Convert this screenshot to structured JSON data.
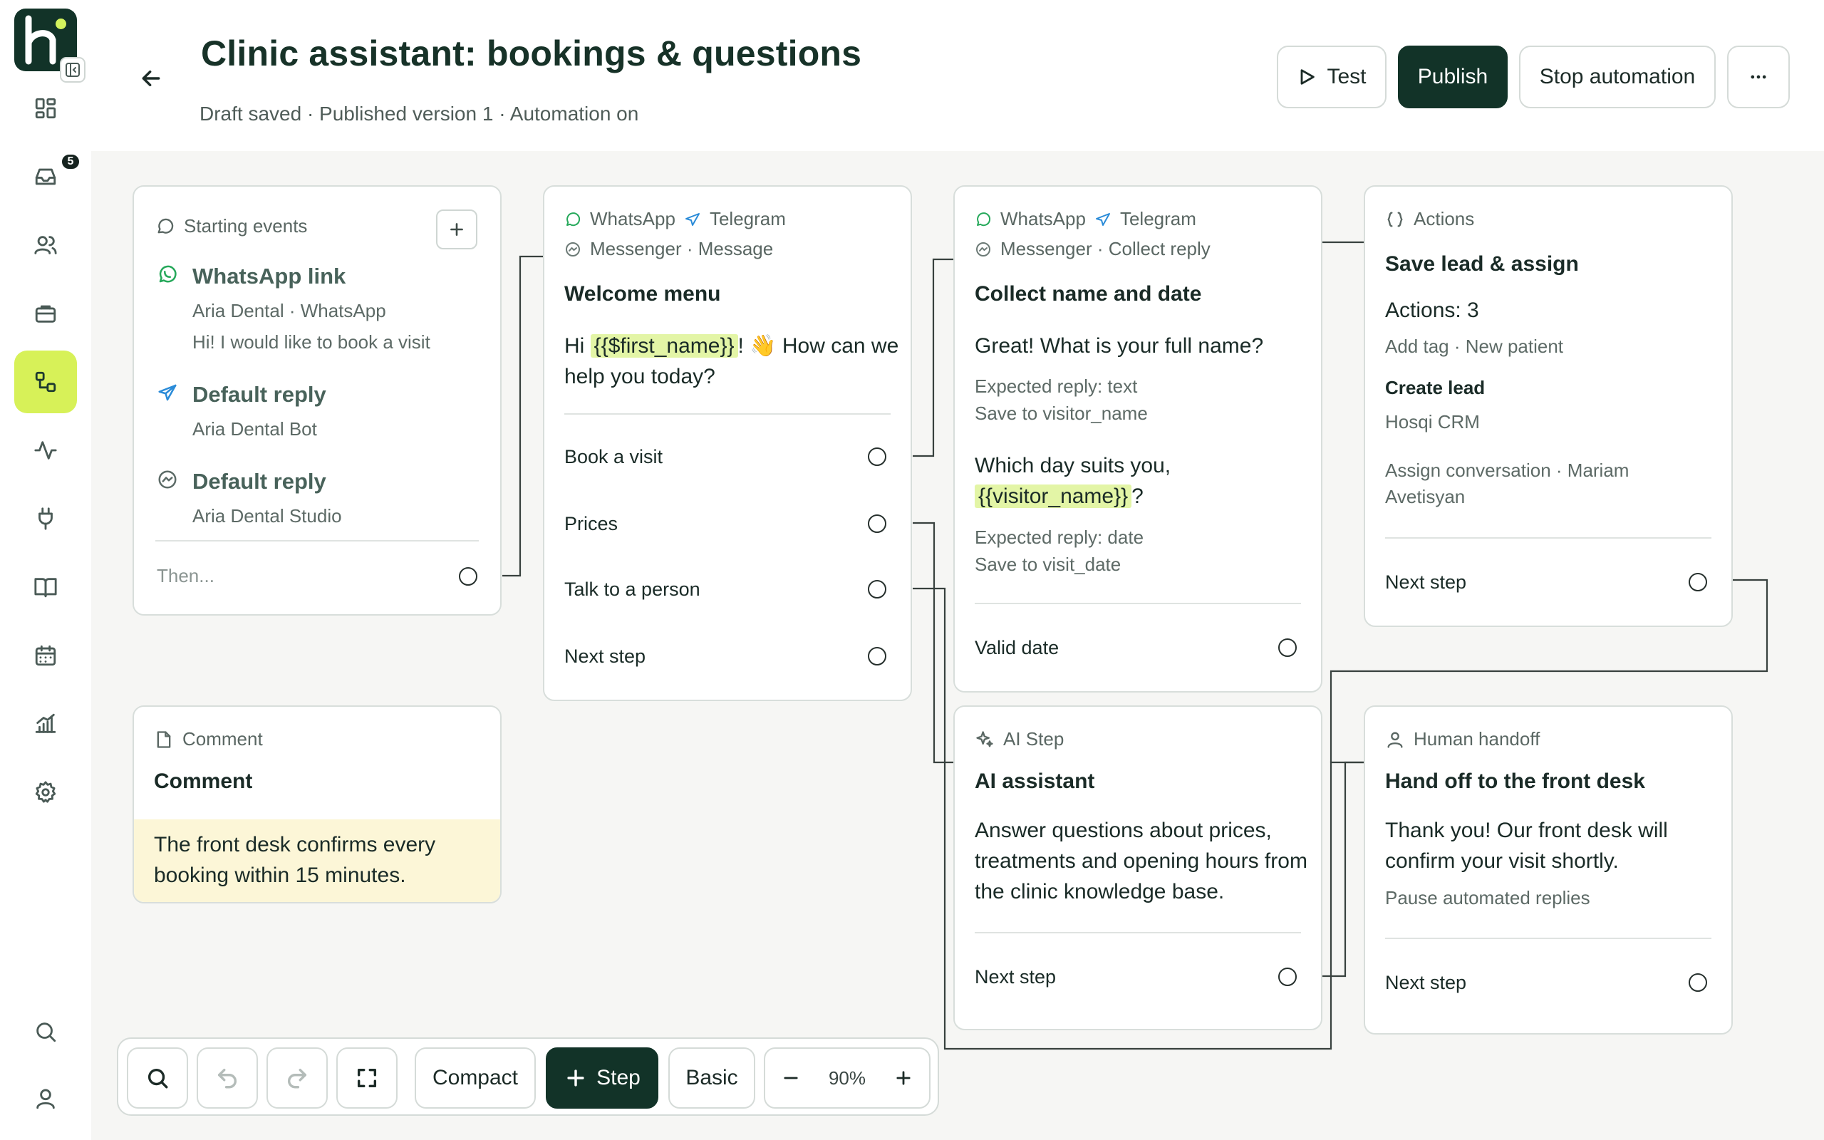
{
  "sidebar": {
    "inbox_badge": "5"
  },
  "header": {
    "title": "Clinic assistant: bookings & questions",
    "subtitle": "Draft saved · Published version 1 · Automation on",
    "test_label": "Test",
    "publish_label": "Publish",
    "stop_label": "Stop automation"
  },
  "cards": {
    "start": {
      "header": "Starting events",
      "triggers": [
        {
          "title": "WhatsApp link",
          "line1": "Aria Dental · WhatsApp",
          "line2": "Hi! I would like to book a visit"
        },
        {
          "title": "Default reply",
          "line1": "Aria Dental Bot"
        },
        {
          "title": "Default reply",
          "line1": "Aria Dental Studio"
        }
      ],
      "then_label": "Then..."
    },
    "comment": {
      "header": "Comment",
      "title": "Comment",
      "text": "The front desk confirms every booking within 15 minutes."
    },
    "welcome": {
      "channel_wa": "WhatsApp",
      "channel_tg": "Telegram",
      "channel_ms": "Messenger · Message",
      "title": "Welcome menu",
      "msg_before": "Hi ",
      "msg_var": "{{$first_name}}",
      "msg_after": "! 👋 How can we help you today?",
      "options": [
        "Book a visit",
        "Prices",
        "Talk to a person",
        "Next step"
      ]
    },
    "collect": {
      "channel_wa": "WhatsApp",
      "channel_tg": "Telegram",
      "channel_ms": "Messenger · Collect reply",
      "title": "Collect name and date",
      "q1": "Great! What is your full name?",
      "q1_expected": "Expected reply: text",
      "q1_save": "Save to visitor_name",
      "q2_before": "Which day suits you, ",
      "q2_var": "{{visitor_name}}",
      "q2_after": "?",
      "q2_expected": "Expected reply: date",
      "q2_save": "Save to visit_date",
      "output": "Valid date"
    },
    "actions": {
      "header": "Actions",
      "title": "Save lead & assign",
      "count": "Actions: 3",
      "tag": "Add tag · New patient",
      "lead_title": "Create lead",
      "lead_target": "Hosqi CRM",
      "assign": "Assign conversation · Mariam Avetisyan",
      "output": "Next step"
    },
    "ai": {
      "header": "AI Step",
      "title": "AI assistant",
      "text": "Answer questions about prices, treatments and opening hours from the clinic knowledge base.",
      "output": "Next step"
    },
    "handoff": {
      "header": "Human handoff",
      "title": "Hand off to the front desk",
      "text": "Thank you! Our front desk will confirm your visit shortly.",
      "note": "Pause automated replies",
      "output": "Next step"
    }
  },
  "toolbar": {
    "compact_label": "Compact",
    "step_label": "Step",
    "basic_label": "Basic",
    "zoom": "90%"
  },
  "colors": {
    "brand_dark": "#123328",
    "accent_lime": "#d7f158",
    "variable_highlight": "#e3f5a6",
    "comment_bg": "#fcf6d7"
  }
}
